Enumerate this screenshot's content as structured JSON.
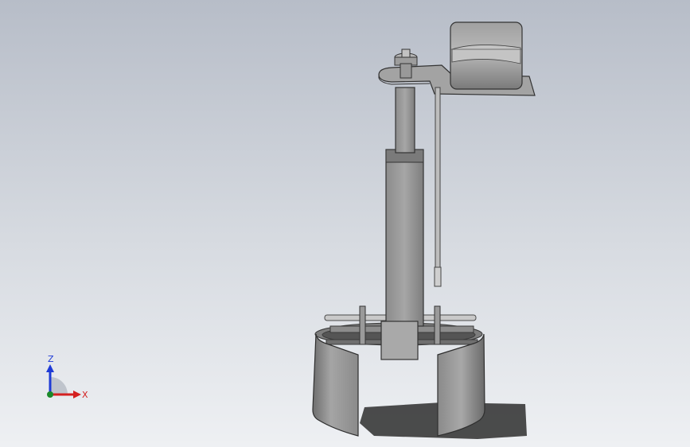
{
  "triad": {
    "z_label": "Z",
    "x_label": "X"
  },
  "colors": {
    "background_top": "#b7bdc8",
    "background_bottom": "#eef0f3",
    "part_fill": "#9a9a9a",
    "part_dark": "#5f5f5f",
    "part_light": "#c8c8c8",
    "shadow": "#3a3a3a",
    "z_axis": "#1f3bd6",
    "x_axis": "#d42020",
    "y_axis": "#1b8a2a"
  }
}
